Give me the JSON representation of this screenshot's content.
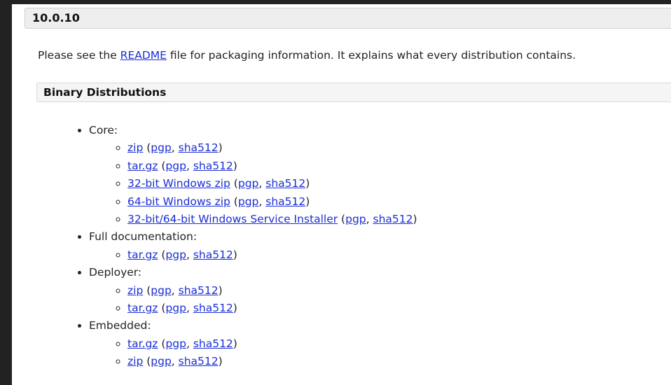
{
  "version": "10.0.10",
  "intro": {
    "prefix": "Please see the ",
    "link": "README",
    "suffix": " file for packaging information. It explains what every distribution contains."
  },
  "section_title": "Binary Distributions",
  "sig_open": " (",
  "sig_sep": ", ",
  "sig_close": ")",
  "groups": [
    {
      "label": "Core:",
      "items": [
        {
          "file": "zip",
          "pgp": "pgp",
          "sha": "sha512"
        },
        {
          "file": "tar.gz",
          "pgp": "pgp",
          "sha": "sha512"
        },
        {
          "file": "32-bit Windows zip",
          "pgp": "pgp",
          "sha": "sha512"
        },
        {
          "file": "64-bit Windows zip",
          "pgp": "pgp",
          "sha": "sha512"
        },
        {
          "file": "32-bit/64-bit Windows Service Installer",
          "pgp": "pgp",
          "sha": "sha512"
        }
      ]
    },
    {
      "label": "Full documentation:",
      "items": [
        {
          "file": "tar.gz",
          "pgp": "pgp",
          "sha": "sha512"
        }
      ]
    },
    {
      "label": "Deployer:",
      "items": [
        {
          "file": "zip",
          "pgp": "pgp",
          "sha": "sha512"
        },
        {
          "file": "tar.gz",
          "pgp": "pgp",
          "sha": "sha512"
        }
      ]
    },
    {
      "label": "Embedded:",
      "items": [
        {
          "file": "tar.gz",
          "pgp": "pgp",
          "sha": "sha512"
        },
        {
          "file": "zip",
          "pgp": "pgp",
          "sha": "sha512"
        }
      ]
    }
  ],
  "colors": {
    "link": "#1a2fd6",
    "text": "#222222",
    "background": "#ffffff",
    "outer_frame": "#222222",
    "version_bar": "#eeeeee",
    "section_bar": "#f5f5f5"
  }
}
